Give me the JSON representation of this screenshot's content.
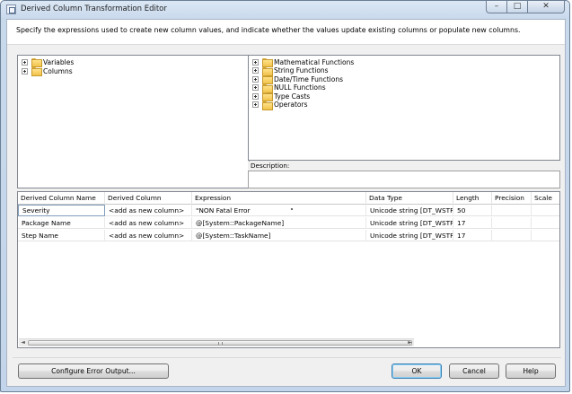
{
  "window": {
    "title": "Derived Column Transformation Editor",
    "controls": {
      "minimize": "–",
      "maximize": "□",
      "close": "✕"
    }
  },
  "instruction": "Specify the expressions used to create new column values, and indicate whether the values update existing columns or populate new columns.",
  "left_tree": {
    "items": [
      {
        "label": "Variables",
        "icon": "folder-icon"
      },
      {
        "label": "Columns",
        "icon": "folder-icon"
      }
    ]
  },
  "right_tree": {
    "items": [
      {
        "label": "Mathematical Functions",
        "icon": "folder-icon"
      },
      {
        "label": "String Functions",
        "icon": "folder-icon"
      },
      {
        "label": "Date/Time Functions",
        "icon": "folder-icon"
      },
      {
        "label": "NULL Functions",
        "icon": "folder-icon"
      },
      {
        "label": "Type Casts",
        "icon": "folder-icon"
      },
      {
        "label": "Operators",
        "icon": "folder-icon"
      }
    ]
  },
  "description": {
    "label": "Description:",
    "text": ""
  },
  "grid": {
    "columns": [
      "Derived Column Name",
      "Derived Column",
      "Expression",
      "Data Type",
      "Length",
      "Precision",
      "Scale"
    ],
    "rows": [
      [
        "Severity",
        "<add as new column>",
        "\"NON Fatal Error                   \"",
        "Unicode string [DT_WSTR]",
        "50",
        "",
        ""
      ],
      [
        "Package Name",
        "<add as new column>",
        "@[System::PackageName]",
        "Unicode string [DT_WSTR]",
        "17",
        "",
        ""
      ],
      [
        "Step Name",
        "<add as new column>",
        "@[System::TaskName]",
        "Unicode string [DT_WSTR]",
        "17",
        "",
        ""
      ]
    ],
    "scroll_left_arrow": "◄",
    "scroll_right_arrow": "►"
  },
  "buttons": {
    "configure": "Configure Error Output...",
    "ok": "OK",
    "cancel": "Cancel",
    "help": "Help"
  },
  "colors": {
    "frame": "#c3d5ea",
    "client": "#f0f0f0",
    "default_button_border": "#3c7fb1"
  }
}
